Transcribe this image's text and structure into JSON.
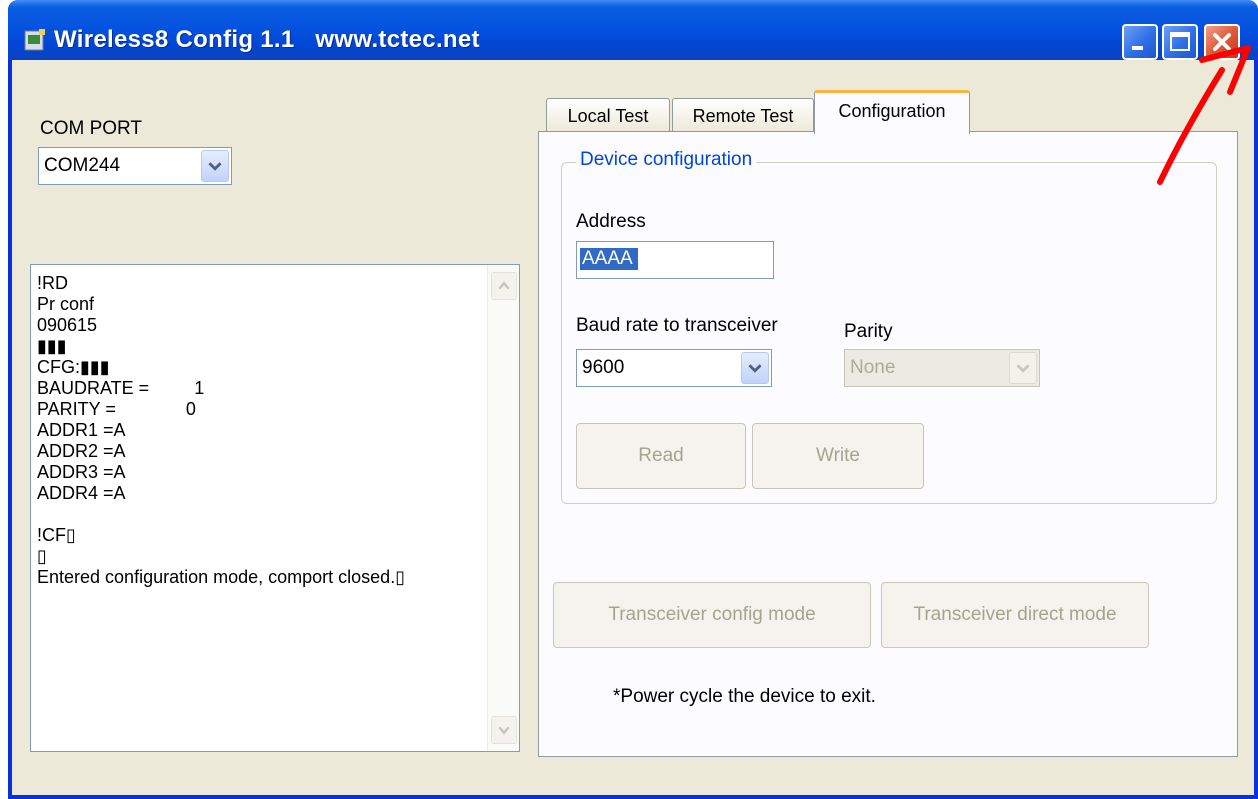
{
  "window": {
    "title": "Wireless8 Config 1.1   www.tctec.net"
  },
  "com_port": {
    "label": "COM PORT",
    "value": "COM244"
  },
  "log": {
    "lines": [
      "!RD",
      "Pr conf",
      "090615",
      "▮▮▮",
      "CFG:▮▮▮",
      "BAUDRATE =         1",
      "PARITY =              0",
      "ADDR1 =A",
      "ADDR2 =A",
      "ADDR3 =A",
      "ADDR4 =A",
      "",
      "!CF▯",
      "▯",
      "Entered configuration mode, comport closed.▯"
    ]
  },
  "tabs": [
    {
      "label": "Local Test",
      "active": false
    },
    {
      "label": "Remote Test",
      "active": false
    },
    {
      "label": "Configuration",
      "active": true
    }
  ],
  "device_config": {
    "group_title": "Device configuration",
    "address_label": "Address",
    "address_value": "AAAA",
    "baud_label": "Baud rate to transceiver",
    "baud_value": "9600",
    "parity_label": "Parity",
    "parity_value": "None",
    "read_label": "Read",
    "write_label": "Write"
  },
  "mode_buttons": {
    "config_mode": "Transceiver config mode",
    "direct_mode": "Transceiver direct mode"
  },
  "note": "*Power cycle the device to exit.",
  "colors": {
    "titlebar": "#0553e0",
    "window_bg": "#ece9d8",
    "group_title": "#0046d5",
    "close_button": "#e05a3a",
    "annotation_arrow": "#ff0000"
  }
}
